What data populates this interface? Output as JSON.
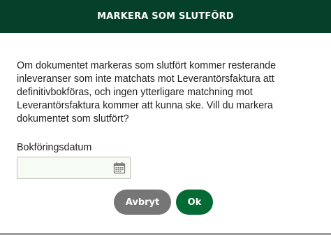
{
  "dialog": {
    "title": "MARKERA SOM SLUTFÖRD",
    "message": "Om dokumentet markeras som slutfört kommer resterande inleveranser som inte matchats mot Leverantörsfaktura att definitivbokföras, och ingen ytterligare matchning mot Leverantörsfaktura kommer att kunna ske. Vill du markera dokumentet som slutfört?",
    "date_field": {
      "label": "Bokföringsdatum",
      "value": "",
      "placeholder": "",
      "icon": "calendar-icon"
    },
    "buttons": {
      "cancel_label": "Avbryt",
      "ok_label": "Ok"
    }
  },
  "colors": {
    "header_bg": "#04402a",
    "ok_button": "#036b33",
    "cancel_button": "#767676",
    "input_bg": "#f6fbf4"
  }
}
